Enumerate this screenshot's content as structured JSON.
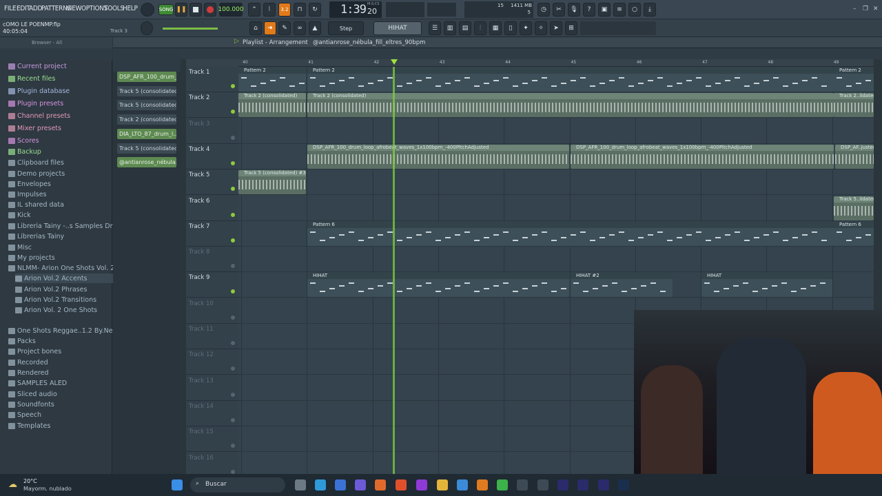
{
  "menu": [
    "FILE",
    "EDIT",
    "ADD",
    "PATTERNS",
    "VIEW",
    "OPTIONS",
    "TOOLS",
    "HELP"
  ],
  "project": {
    "filename": "cOMO LE POENMP.flp",
    "time": "40:05:04",
    "track_hint": "Track 3"
  },
  "transport": {
    "mode": "SONG",
    "tempo": "100.000",
    "time": "1:39",
    "time_small": "20",
    "time_label": "M:S:CS"
  },
  "toolbar": {
    "snap": "Step",
    "hihat": "HIHAT"
  },
  "cpu": {
    "mem": "1411 MB",
    "cpu": "15",
    "voices": "5"
  },
  "browser": {
    "label": "Browser - All"
  },
  "sidebar": [
    {
      "label": "Current project",
      "color": "#c79be0"
    },
    {
      "label": "Recent files",
      "color": "#9be08f"
    },
    {
      "label": "Plugin database",
      "color": "#a7b8e0"
    },
    {
      "label": "Plugin presets",
      "color": "#d893e0"
    },
    {
      "label": "Channel presets",
      "color": "#e39ab7"
    },
    {
      "label": "Mixer presets",
      "color": "#e39ab7"
    },
    {
      "label": "Scores",
      "color": "#d893e0"
    },
    {
      "label": "Backup",
      "color": "#9be08f"
    },
    {
      "label": "Clipboard files",
      "color": "#a7b8c4"
    },
    {
      "label": "Demo projects",
      "color": "#a7b8c4"
    },
    {
      "label": "Envelopes",
      "color": "#a7b8c4"
    },
    {
      "label": "Impulses",
      "color": "#a7b8c4"
    },
    {
      "label": "IL shared data",
      "color": "#a7b8c4"
    },
    {
      "label": "Kick",
      "color": "#a7b8c4"
    },
    {
      "label": "Libreria Tainy -..s Samples Drum Kit",
      "color": "#a7b8c4"
    },
    {
      "label": "Librerias Tainy",
      "color": "#a7b8c4"
    },
    {
      "label": "Misc",
      "color": "#a7b8c4"
    },
    {
      "label": "My projects",
      "color": "#a7b8c4"
    },
    {
      "label": "NLMM- Arion One Shots Vol. 2",
      "color": "#a7b8c4"
    },
    {
      "label": "Arion Vol.2 Accents",
      "color": "#a7b8c4"
    },
    {
      "label": "Arion Vol.2 Phrases",
      "color": "#a7b8c4"
    },
    {
      "label": "Arion Vol.2 Transitions",
      "color": "#a7b8c4"
    },
    {
      "label": "Arion Vol. 2 One Shots",
      "color": "#a7b8c4"
    },
    {
      "label": "One Shots Reggae..1.2 By.Neo Beats",
      "color": "#a7b8c4"
    },
    {
      "label": "Packs",
      "color": "#a7b8c4"
    },
    {
      "label": "Project bones",
      "color": "#a7b8c4"
    },
    {
      "label": "Recorded",
      "color": "#a7b8c4"
    },
    {
      "label": "Rendered",
      "color": "#a7b8c4"
    },
    {
      "label": "SAMPLES ALED",
      "color": "#a7b8c4"
    },
    {
      "label": "Sliced audio",
      "color": "#a7b8c4"
    },
    {
      "label": "Soundfonts",
      "color": "#a7b8c4"
    },
    {
      "label": "Speech",
      "color": "#a7b8c4"
    },
    {
      "label": "Templates",
      "color": "#a7b8c4"
    }
  ],
  "channels": [
    {
      "label": "DSP_AFR_100_drum_",
      "green": true
    },
    {
      "label": "Track 5 (consolidated)",
      "green": false
    },
    {
      "label": "Track 5 (consolidated...",
      "green": false
    },
    {
      "label": "Track 2 (consolidated)",
      "green": false
    },
    {
      "label": "DIA_LTO_87_drum_l...",
      "green": true
    },
    {
      "label": "Track 5 (consolidated...",
      "green": false
    },
    {
      "label": "@antianrose_nébula...",
      "green": true
    }
  ],
  "playlist": {
    "title": "Playlist - Arrangement",
    "pattern": "@antianrose_nébula_fill_eltres_90bpm"
  },
  "ruler": [
    "40",
    "41",
    "42",
    "43",
    "44",
    "45",
    "46",
    "47",
    "48",
    "49"
  ],
  "tracks": [
    {
      "label": "Track 1",
      "dim": false
    },
    {
      "label": "Track 2",
      "dim": false
    },
    {
      "label": "Track 3",
      "dim": true
    },
    {
      "label": "Track 4",
      "dim": false
    },
    {
      "label": "Track 5",
      "dim": false
    },
    {
      "label": "Track 6",
      "dim": false
    },
    {
      "label": "Track 7",
      "dim": false
    },
    {
      "label": "Track 8",
      "dim": true
    },
    {
      "label": "Track 9",
      "dim": false
    },
    {
      "label": "Track 10",
      "dim": true
    },
    {
      "label": "Track 11",
      "dim": true
    },
    {
      "label": "Track 12",
      "dim": true
    },
    {
      "label": "Track 13",
      "dim": true
    },
    {
      "label": "Track 14",
      "dim": true
    },
    {
      "label": "Track 15",
      "dim": true
    },
    {
      "label": "Track 16",
      "dim": true
    }
  ],
  "clips": {
    "t1a": "Pattern 2",
    "t1b": "Pattern 2",
    "t1c": "Pattern 2",
    "t2a": "Track 2 (consolidated)",
    "t2b": "Track 2 (consolidated)",
    "t2c": "Track 2..lidated)",
    "t4a": "DSP_AFR_100_drum_loop_afrobeat_waves_1x100bpm_-400PitchAdjusted",
    "t4b": "DSP_AFR_100_drum_loop_afrobeat_waves_1x100bpm_-400PitchAdjusted",
    "t4c": "DSP_AF..justed",
    "t5a": "Track 5 (consolidated) #3",
    "t6a": "Track 5..lidated)",
    "t7a": "Pattern 6",
    "t7b": "Pattern 6",
    "t9a": "HIHAT",
    "t9b": "HIHAT #2",
    "t9c": "HIHAT"
  },
  "taskbar": {
    "temp": "20°C",
    "weather": "Mayorm. nublado",
    "search": "Buscar"
  }
}
